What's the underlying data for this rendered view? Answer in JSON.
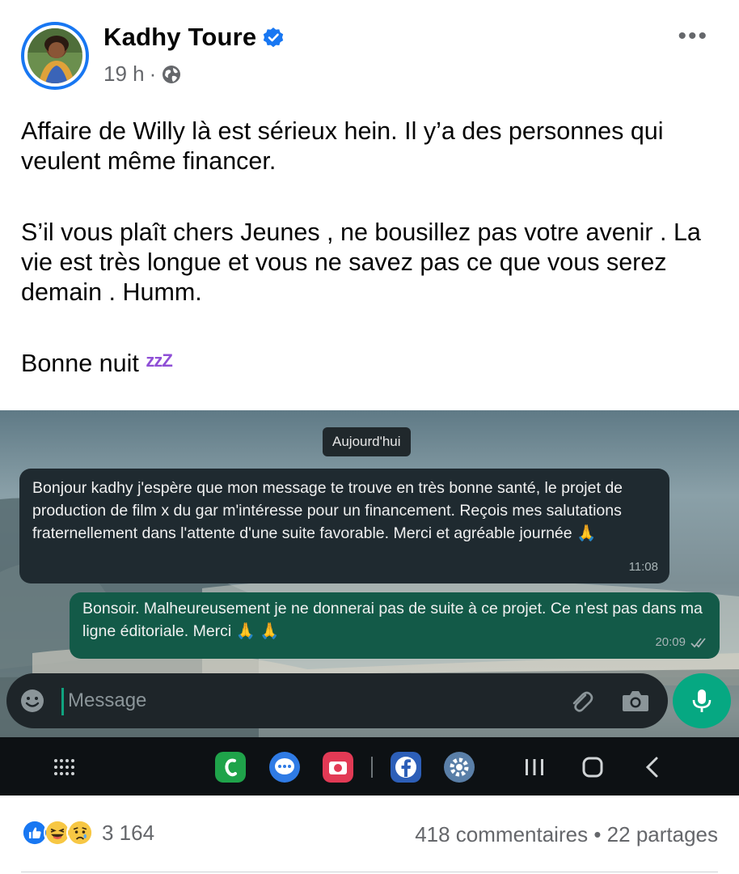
{
  "post": {
    "author": "Kadhy Toure",
    "time": "19 h",
    "separator": "·",
    "paragraphs": [
      "Affaire de Willy là est sérieux hein. Il y’a des personnes qui veulent même financer.",
      "S’il vous plaît chers Jeunes , ne bousillez pas votre avenir . La vie est très longue et vous ne savez pas ce que vous serez demain . Humm.",
      "Bonne nuit"
    ],
    "sleep_emoji": "zzZ"
  },
  "screenshot": {
    "date_chip": "Aujourd'hui",
    "incoming": {
      "text": "Bonjour kadhy j'espère que mon message te trouve en très bonne santé,  le projet de production de film x du gar m'intéresse pour un financement. Reçois mes salutations fraternellement dans l'attente d'une suite favorable.  Merci et agréable journée 🙏",
      "time": "11:08"
    },
    "outgoing": {
      "text": "Bonsoir. Malheureusement je ne donnerai pas de suite à ce projet.  Ce n'est pas dans ma ligne éditoriale.  Merci 🙏 🙏",
      "time": "20:09"
    },
    "input_placeholder": "Message",
    "icons": [
      "emoji-icon",
      "paperclip-icon",
      "camera-icon",
      "mic-icon",
      "apps-grid-icon",
      "phone-app-icon",
      "messages-app-icon",
      "camera-app-icon",
      "facebook-app-icon",
      "settings-app-icon",
      "recents-icon",
      "home-icon",
      "back-icon"
    ]
  },
  "footer": {
    "reaction_count": "3 164",
    "comments": "418 commentaires",
    "dot": "•",
    "shares": "22 partages"
  },
  "colors": {
    "facebook_blue": "#1877f2",
    "whatsapp_green": "#06a882",
    "outgoing_bubble": "#135a48",
    "incoming_bubble": "#1f2a30",
    "muted_text": "#65676b"
  }
}
